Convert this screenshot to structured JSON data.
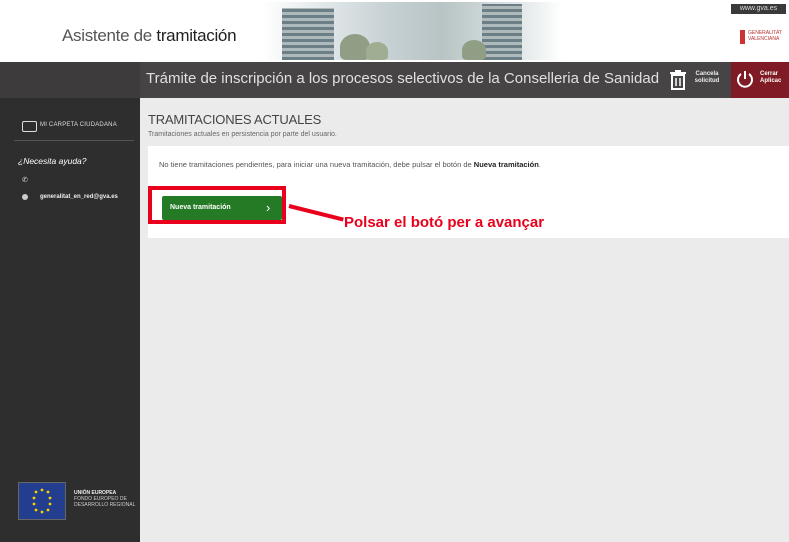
{
  "header": {
    "title_light": "Asistente de ",
    "title_bold": "tramitación",
    "url": "www.gva.es",
    "logo_text": "GENERALITAT VALENCIANA"
  },
  "topbar": {
    "procedure_title": "Trámite de inscripción a los procesos selectivos de la Conselleria de Sanidad Universal y S",
    "cancel_label": "Cancela solicitud",
    "close_label": "Cerrar Aplicac"
  },
  "sidebar": {
    "folder_label": "MI CARPETA CIUDADANA",
    "help_title": "¿Necesita ayuda?",
    "email": "generalitat_en_red@gva.es",
    "eu_title": "UNIÓN EUROPEA",
    "eu_subtitle": "FONDO EUROPEO DE DESARROLLO REGIONAL"
  },
  "main": {
    "section_title": "TRAMITACIONES ACTUALES",
    "section_subtitle": "Tramitaciones actuales en persistencia por parte del usuario.",
    "notice_prefix": "No tiene tramitaciones pendientes, para iniciar una nueva tramitación, debe pulsar el botón de ",
    "notice_bold": "Nueva tramitación",
    "notice_suffix": ".",
    "new_button_label": "Nueva tramitación"
  },
  "annotation": {
    "text": "Polsar el botó per a avançar",
    "color": "#e8001c"
  },
  "colors": {
    "topbar": "#464444",
    "sidebar": "#2f2e2e",
    "close_box": "#7f1b24",
    "button_green": "#257a25"
  }
}
